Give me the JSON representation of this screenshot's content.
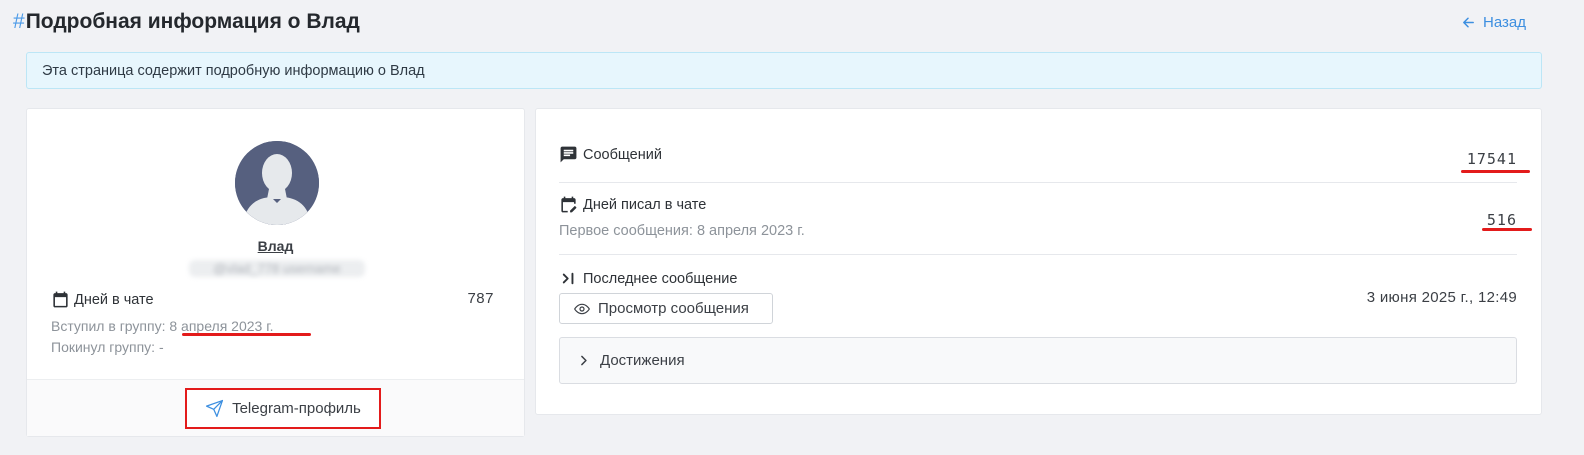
{
  "header": {
    "hash": "#",
    "title": "Подробная информация о Влад",
    "back_label": "Назад"
  },
  "banner": {
    "text": "Эта страница содержит подробную информацию о Влад"
  },
  "profile": {
    "name": "Влад",
    "handle": "@vlad_778 username",
    "days_in_chat_label": "Дней в чате",
    "days_in_chat_value": "787",
    "joined_label": "Вступил в группу:",
    "joined_value": "8 апреля 2023 г.",
    "left_label": "Покинул группу:",
    "left_value": "-",
    "telegram_button": "Telegram-профиль"
  },
  "stats": {
    "messages_label": "Сообщений",
    "messages_value": "17541",
    "days_wrote_label": "Дней писал в чате",
    "first_message": "Первое сообщения: 8 апреля 2023 г.",
    "days_wrote_value": "516",
    "last_message_label": "Последнее сообщение",
    "view_message_button": "Просмотр сообщения",
    "last_message_value": "3 июня 2025 г., 12:49",
    "achievements_label": "Достижения"
  },
  "colors": {
    "accent": "#3d8fe0",
    "highlight_red": "#e31b1b",
    "banner_bg": "#e7f6fd"
  }
}
